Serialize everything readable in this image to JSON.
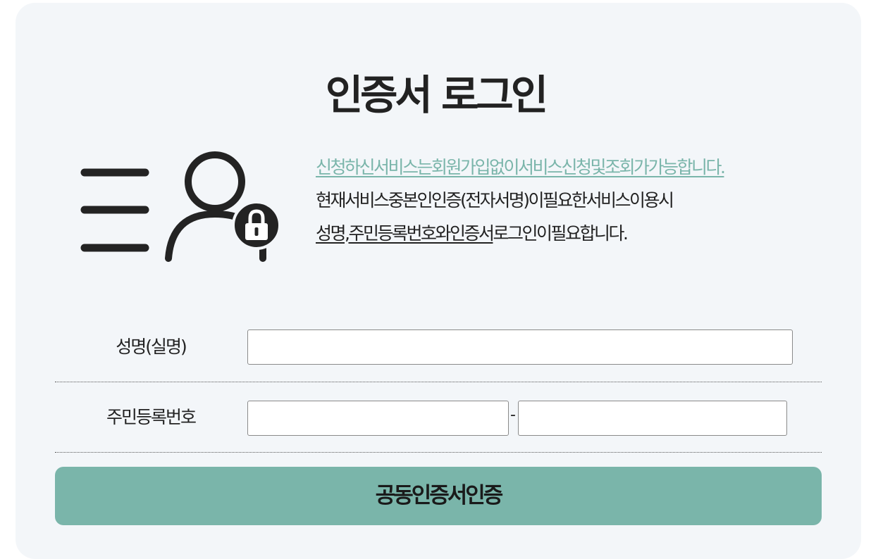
{
  "page": {
    "title": "인증서 로그인"
  },
  "illustration": {
    "icon": "user-lock-icon"
  },
  "description": {
    "line1": "신청하신서비스는회원가입없이서비스신청및조회가가능합니다.",
    "line2": "현재서비스중본인인증(전자서명)이필요한서비스이용시",
    "line3_name": "성명",
    "line3_comma": ",",
    "line3_underlined": "주민등록번호와인증서",
    "line3_rest": "로그인이필요합니다."
  },
  "form": {
    "name_label": "성명(실명)",
    "name_value": "",
    "rrn_label": "주민등록번호",
    "rrn_front_value": "",
    "rrn_separator": "-",
    "rrn_back_value": ""
  },
  "submit": {
    "label": "공동인증서인증"
  },
  "colors": {
    "accent": "#7ab5aa",
    "card_background": "#f3f6f9",
    "text": "#222222"
  }
}
